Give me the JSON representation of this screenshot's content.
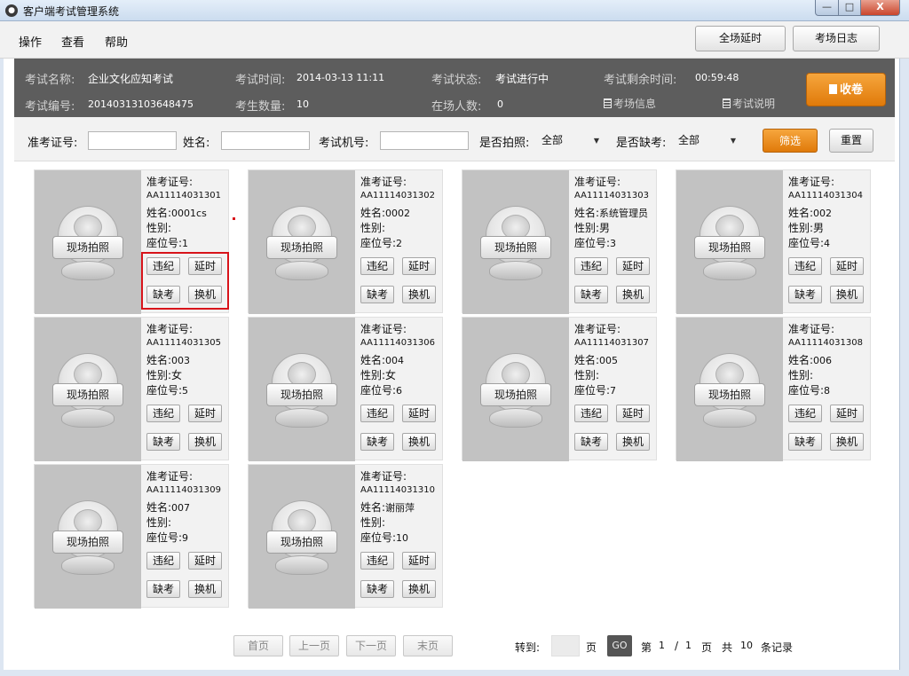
{
  "window": {
    "title": "客户端考试管理系统",
    "min": "—",
    "max": "□",
    "close": "X"
  },
  "menu": {
    "items": [
      "操作",
      "查看",
      "帮助"
    ],
    "extend_all": "全场延时",
    "exam_log": "考场日志"
  },
  "exam": {
    "name_label": "考试名称:",
    "name": "企业文化应知考试",
    "code_label": "考试编号:",
    "code": "20140313103648475",
    "time_label": "考试时间:",
    "time": "2014-03-13 11:11",
    "count_label": "考生数量:",
    "count": "10",
    "status_label": "考试状态:",
    "status": "考试进行中",
    "present_label": "在场人数:",
    "present": "0",
    "remaining_label": "考试剩余时间:",
    "remaining": "00:59:48",
    "room_info": "考场信息",
    "exam_desc": "考试说明",
    "collapse": "收卷"
  },
  "filter": {
    "ticket_label": "准考证号:",
    "ticket_value": "",
    "name_label": "姓名:",
    "name_value": "",
    "machine_label": "考试机号:",
    "machine_value": "",
    "photo_label": "是否拍照:",
    "photo_value": "全部",
    "absent_label": "是否缺考:",
    "absent_value": "全部",
    "filter_btn": "筛选",
    "reset_btn": "重置"
  },
  "card_labels": {
    "ticket": "准考证号:",
    "name": "姓名:",
    "gender": "性别:",
    "seat": "座位号:",
    "photo_btn": "现场拍照",
    "violation": "违纪",
    "extend": "延时",
    "absent": "缺考",
    "swap": "换机"
  },
  "candidates": [
    {
      "ticket": "AA11114031301",
      "name": "0001cs",
      "gender": "",
      "seat": "1"
    },
    {
      "ticket": "AA11114031302",
      "name": "0002",
      "gender": "",
      "seat": "2"
    },
    {
      "ticket": "AA11114031303",
      "name": "系统管理员",
      "gender": "男",
      "seat": "3"
    },
    {
      "ticket": "AA11114031304",
      "name": "002",
      "gender": "男",
      "seat": "4"
    },
    {
      "ticket": "AA11114031305",
      "name": "003",
      "gender": "女",
      "seat": "5"
    },
    {
      "ticket": "AA11114031306",
      "name": "004",
      "gender": "女",
      "seat": "6"
    },
    {
      "ticket": "AA11114031307",
      "name": "005",
      "gender": "",
      "seat": "7"
    },
    {
      "ticket": "AA11114031308",
      "name": "006",
      "gender": "",
      "seat": "8"
    },
    {
      "ticket": "AA11114031309",
      "name": "007",
      "gender": "",
      "seat": "9"
    },
    {
      "ticket": "AA11114031310",
      "name": "谢丽萍",
      "gender": "",
      "seat": "10"
    }
  ],
  "pagination": {
    "first": "首页",
    "prev": "上一页",
    "next": "下一页",
    "last": "末页",
    "goto_label": "转到:",
    "goto_value": "",
    "page_unit": "页",
    "go": "GO",
    "page_prefix": "第",
    "current_page": "1",
    "separator": "/",
    "total_pages": "1",
    "page_suffix": "页",
    "total_prefix": "共",
    "total_records": "10",
    "total_suffix": "条记录"
  },
  "colors": {
    "accent_orange": "#e8870f",
    "info_bar": "#5d5d5d",
    "highlight_red": "#d8141b"
  }
}
